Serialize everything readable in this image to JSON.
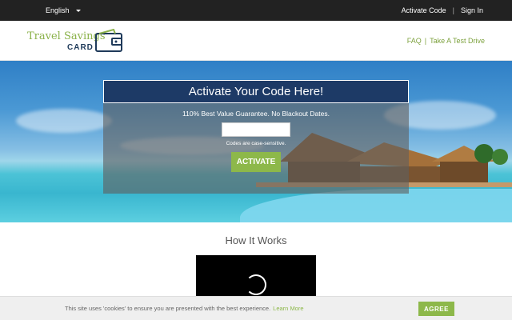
{
  "topbar": {
    "language": "English",
    "activate_code": "Activate Code",
    "separator": "|",
    "sign_in": "Sign In"
  },
  "header": {
    "logo_line1": "Travel Savings",
    "logo_line2": "CARD",
    "faq": "FAQ",
    "separator": "|",
    "test_drive": "Take A Test Drive"
  },
  "hero": {
    "panel_title": "Activate Your Code Here!",
    "guarantee": "110% Best Value Guarantee. No Blackout Dates.",
    "code_input_value": "",
    "case_note": "Codes are case-sensitive.",
    "activate_label": "ACTIVATE"
  },
  "how_it_works": {
    "title": "How It Works"
  },
  "cookie": {
    "message": "This site uses 'cookies' to ensure you are presented with the best experience.",
    "learn_more": "Learn More",
    "agree_label": "AGREE"
  },
  "colors": {
    "topbar": "#222222",
    "panel_head": "#1d3a66",
    "accent_green": "#8db84a",
    "logo_navy": "#1f3a5a"
  },
  "icons": [
    "caret-down-icon",
    "wallet-icon",
    "loading-spinner-icon"
  ]
}
